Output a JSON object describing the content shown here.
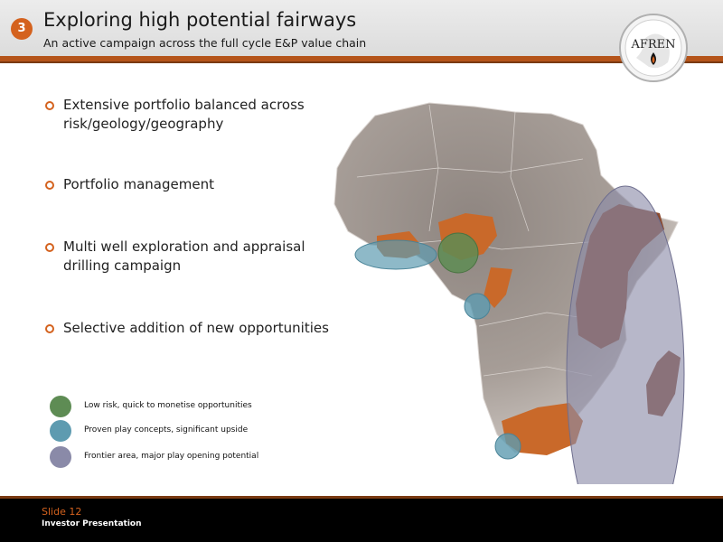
{
  "header": {
    "slide_number": "3",
    "title": "Exploring high potential fairways",
    "subtitle": "An active campaign across the full cycle E&P value chain",
    "logo_text": "AFREN"
  },
  "bullets": [
    {
      "text": "Extensive portfolio balanced across risk/geology/geography"
    },
    {
      "text": "Portfolio management"
    },
    {
      "text": "Multi well exploration and appraisal drilling campaign"
    },
    {
      "text": "Selective addition of new opportunities"
    }
  ],
  "legend": [
    {
      "label": "Low risk, quick to monetise opportunities",
      "color": "#5e8c54"
    },
    {
      "label": "Proven play concepts, significant upside",
      "color": "#5e9bb0"
    },
    {
      "label": "Frontier area, major play opening potential",
      "color": "#8a8aa8"
    }
  ],
  "footer": {
    "slide_label": "Slide 12",
    "presentation": "Investor Presentation"
  },
  "colors": {
    "accent": "#d4621e",
    "rule": "#b5541a",
    "country_highlight": "#c9692a"
  }
}
